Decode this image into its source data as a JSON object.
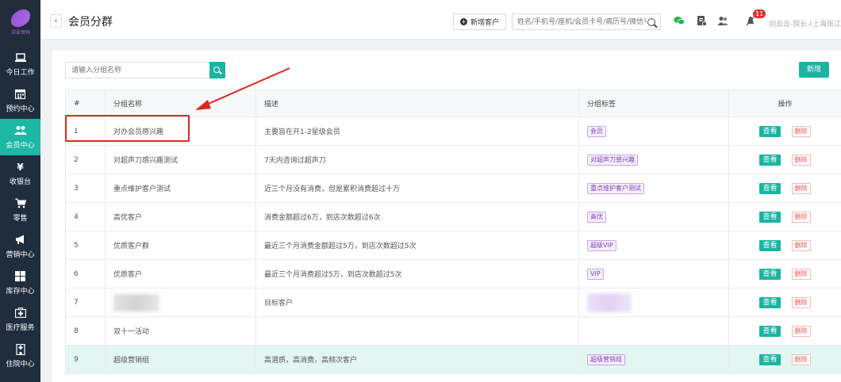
{
  "sidebar": {
    "logo_text": "戎盈营销",
    "items": [
      {
        "label": "今日工作",
        "icon": "laptop-icon",
        "active": false
      },
      {
        "label": "预约中心",
        "icon": "calendar-icon",
        "active": false
      },
      {
        "label": "会员中心",
        "icon": "users-icon",
        "active": true
      },
      {
        "label": "收银台",
        "icon": "yen-icon",
        "active": false
      },
      {
        "label": "零售",
        "icon": "cart-icon",
        "active": false
      },
      {
        "label": "营销中心",
        "icon": "megaphone-icon",
        "active": false
      },
      {
        "label": "库存中心",
        "icon": "grid-icon",
        "active": false
      },
      {
        "label": "医疗服务",
        "icon": "medkit-icon",
        "active": false
      },
      {
        "label": "住院中心",
        "icon": "building-icon",
        "active": false
      }
    ]
  },
  "header": {
    "back_symbol": "‹",
    "title": "会员分群",
    "new_customer": "新增客户",
    "search_placeholder": "姓名/手机号/座机/会员卡号/病历号/微信号",
    "notification_count": "11",
    "user": "刘云云-院长-(上海张江店)"
  },
  "toolbar": {
    "group_search_placeholder": "请输入分组名称",
    "add_label": "新增"
  },
  "table": {
    "headers": {
      "num": "#",
      "name": "分组名称",
      "desc": "描述",
      "tag": "分组标签",
      "op": "操作"
    },
    "view_label": "查看",
    "delete_label": "删除",
    "rows": [
      {
        "num": "1",
        "name": "对办会员感兴趣",
        "desc": "主要旨在开1-2星级会员",
        "tag": "会员"
      },
      {
        "num": "2",
        "name": "对超声刀感兴趣测试",
        "desc": "7天内咨询过超声刀",
        "tag": "对超声刀感兴趣"
      },
      {
        "num": "3",
        "name": "重点维护客户测试",
        "desc": "近三个月没有消费，但是累积消费超过十万",
        "tag": "重点维护客户测试"
      },
      {
        "num": "4",
        "name": "高优客户",
        "desc": "消费金额超过6万，到店次数超过6次",
        "tag": "高优"
      },
      {
        "num": "5",
        "name": "优质客户群",
        "desc": "最近三个月消费金额超过5万，到店次数超过5次",
        "tag": "超级VIP"
      },
      {
        "num": "6",
        "name": "优质客户",
        "desc": "最近三个月消费超过5万，到店次数超过5次",
        "tag": "VIP"
      },
      {
        "num": "7",
        "name": "",
        "desc": "目标客户",
        "tag": ""
      },
      {
        "num": "8",
        "name": "双十一活动",
        "desc": "",
        "tag": ""
      },
      {
        "num": "9",
        "name": "超级营销组",
        "desc": "高潜质，高消费，高频次客户",
        "tag": "超级营销组"
      }
    ]
  },
  "colors": {
    "accent": "#1bb4a2",
    "sidebar_bg": "#1f2d3d",
    "highlight_row": "#e3f6f2",
    "annotation_red": "#e0251f",
    "tag_purple": "#7c3fb5"
  }
}
